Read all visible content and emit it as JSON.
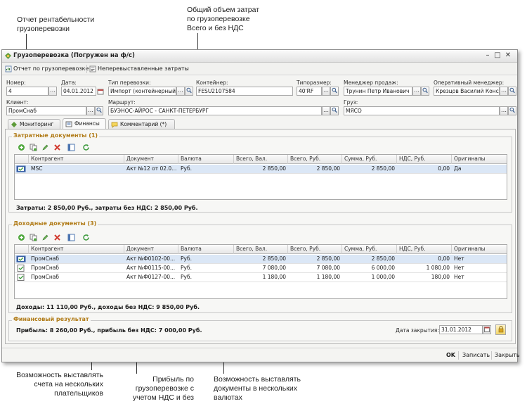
{
  "annotations": {
    "top_left": [
      "Отчет рентабельности",
      "грузоперевозки"
    ],
    "top_center": [
      "Общий объем затрат",
      "по грузоперевозке",
      "Всего и без НДС"
    ],
    "bottom_left": [
      "Возможность выставлять",
      "счета на нескольких",
      "плательщиков"
    ],
    "bottom_center": [
      "Прибыль по",
      "грузоперевозке с",
      "учетом НДС и без"
    ],
    "bottom_right": [
      "Возможность выставлять",
      "документы в нескольких",
      "валютах"
    ]
  },
  "window": {
    "title": "Грузоперевозка (Погружен на ф/с)",
    "controls": [
      "–",
      "□",
      "✕"
    ]
  },
  "toolbar": {
    "report_label": "Отчет по грузоперевозке",
    "unbilled_label": "Неперевыставленные затраты"
  },
  "form": {
    "number": {
      "label": "Номер:",
      "value": "4"
    },
    "date": {
      "label": "Дата:",
      "value": "04.01.2012"
    },
    "transport_type": {
      "label": "Тип перевозки:",
      "value": "Импорт (контейнерный)"
    },
    "container": {
      "label": "Контейнер:",
      "value": "FESU2107584"
    },
    "size_type": {
      "label": "Типоразмер:",
      "value": "40'RF"
    },
    "sales_manager": {
      "label": "Менеджер продаж:",
      "value": "Трунин Петр Иванович"
    },
    "ops_manager": {
      "label": "Оперативный менеджер:",
      "value": "Крезцов  Василий Констант"
    },
    "client": {
      "label": "Клиент:",
      "value": "ПромСнаб"
    },
    "route": {
      "label": "Маршрут:",
      "value": "БУЭНОС-АЙРОС - САНКТ-ПЕТЕРБУРГ"
    },
    "cargo": {
      "label": "Груз:",
      "value": "МЯСО"
    }
  },
  "tabs": [
    "Мониторинг",
    "Финансы",
    "Комментарий (*)"
  ],
  "columns": [
    "Контрагент",
    "Документ",
    "Валюта",
    "Всего, Вал.",
    "Всего, Руб.",
    "Сумма, Руб.",
    "НДС, Руб.",
    "Оригиналы"
  ],
  "expenses": {
    "title": "Затратные документы (1)",
    "rows": [
      [
        "MSC",
        "Акт №12 от 02.0...",
        "Руб.",
        "2 850,00",
        "2 850,00",
        "2 850,00",
        "0,00",
        "Да"
      ]
    ],
    "total": "Затраты: 2 850,00 Руб., затраты без НДС: 2 850,00 Руб."
  },
  "income": {
    "title": "Доходные документы (3)",
    "rows": [
      [
        "ПромСнаб",
        "Акт №Ф0102-00...",
        "Руб.",
        "2 850,00",
        "2 850,00",
        "2 850,00",
        "0,00",
        "Нет"
      ],
      [
        "ПромСнаб",
        "Акт №Ф0115-00...",
        "Руб.",
        "7 080,00",
        "7 080,00",
        "6 000,00",
        "1 080,00",
        "Нет"
      ],
      [
        "ПромСнаб",
        "Акт №Ф0127-00...",
        "Руб.",
        "1 180,00",
        "1 180,00",
        "1 000,00",
        "180,00",
        "Нет"
      ]
    ],
    "total": "Доходы: 11 110,00 Руб., доходы без НДС: 9 850,00 Руб."
  },
  "result": {
    "title": "Финансовый результат",
    "profit": "Прибыль: 8 260,00 Руб., прибыль без НДС: 7 000,00 Руб.",
    "close_label": "Дата закрытия:",
    "close_date": "31.01.2012"
  },
  "footer": {
    "ok": "OK",
    "save": "Записать",
    "close": "Закрыть"
  },
  "colors": {
    "group_title": "#b07a15",
    "selection": "#dbe7f6"
  }
}
